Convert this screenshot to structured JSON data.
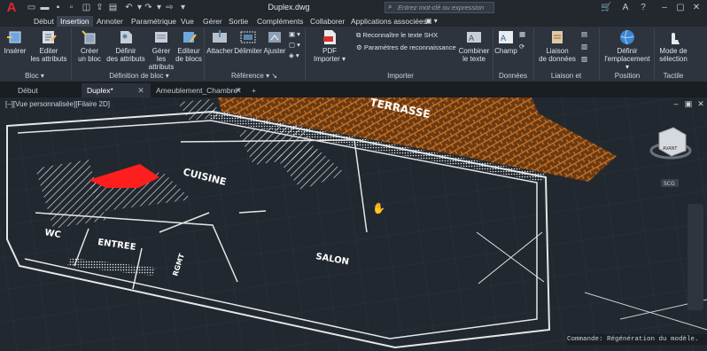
{
  "titlebar": {
    "title": "Duplex.dwg",
    "search_placeholder": "Entrez mot-clé ou expression",
    "brand_color": "#e0262f"
  },
  "menus": [
    "Début",
    "Insertion",
    "Annoter",
    "Paramétrique",
    "Vue",
    "Gérer",
    "Sortie",
    "Compléments",
    "Collaborer",
    "Applications associées"
  ],
  "ribbon": {
    "bloc": {
      "inserer": "Insérer",
      "editer": "Editer\nles attributs",
      "title": "Bloc"
    },
    "definition": {
      "creer": "Créer\nun bloc",
      "definir": "Définir\ndes attributs",
      "gerer": "Gérer les\nattributs",
      "editeur": "Editeur\nde blocs",
      "title": "Définition de bloc"
    },
    "reference": {
      "attacher": "Attacher",
      "delimiter": "Délimiter",
      "ajuster": "Ajuster",
      "title": "Référence"
    },
    "importer": {
      "pdf": "PDF\nImporter",
      "shx": "Reconnaître le texte SHX",
      "params": "Paramètres de reconnaissance",
      "combiner": "Combiner\nle texte",
      "title": "Importer"
    },
    "donnees": {
      "champ": "Champ",
      "title": "Données"
    },
    "liaison": {
      "liaison": "Liaison\nde données",
      "title": "Liaison et extraction"
    },
    "position": {
      "definir": "Définir\nl'emplacement",
      "title": "Position"
    },
    "tactile": {
      "mode": "Mode de\nsélection",
      "title": "Tactile"
    }
  },
  "file_tabs": [
    "Début",
    "Duplex*",
    "Ameublement_Chambre*"
  ],
  "viewport": {
    "label": "[–][Vue personnalisée][Filaire 2D]",
    "rooms": [
      "CUISINE",
      "WC",
      "ENTREE",
      "SALON",
      "RGMT",
      "TERRASSE"
    ],
    "viewcube_face": "AVANT",
    "scu": "SCG",
    "highlight_color": "#ff1e1e"
  },
  "command_line": "Commande:  Régénération du modèle."
}
